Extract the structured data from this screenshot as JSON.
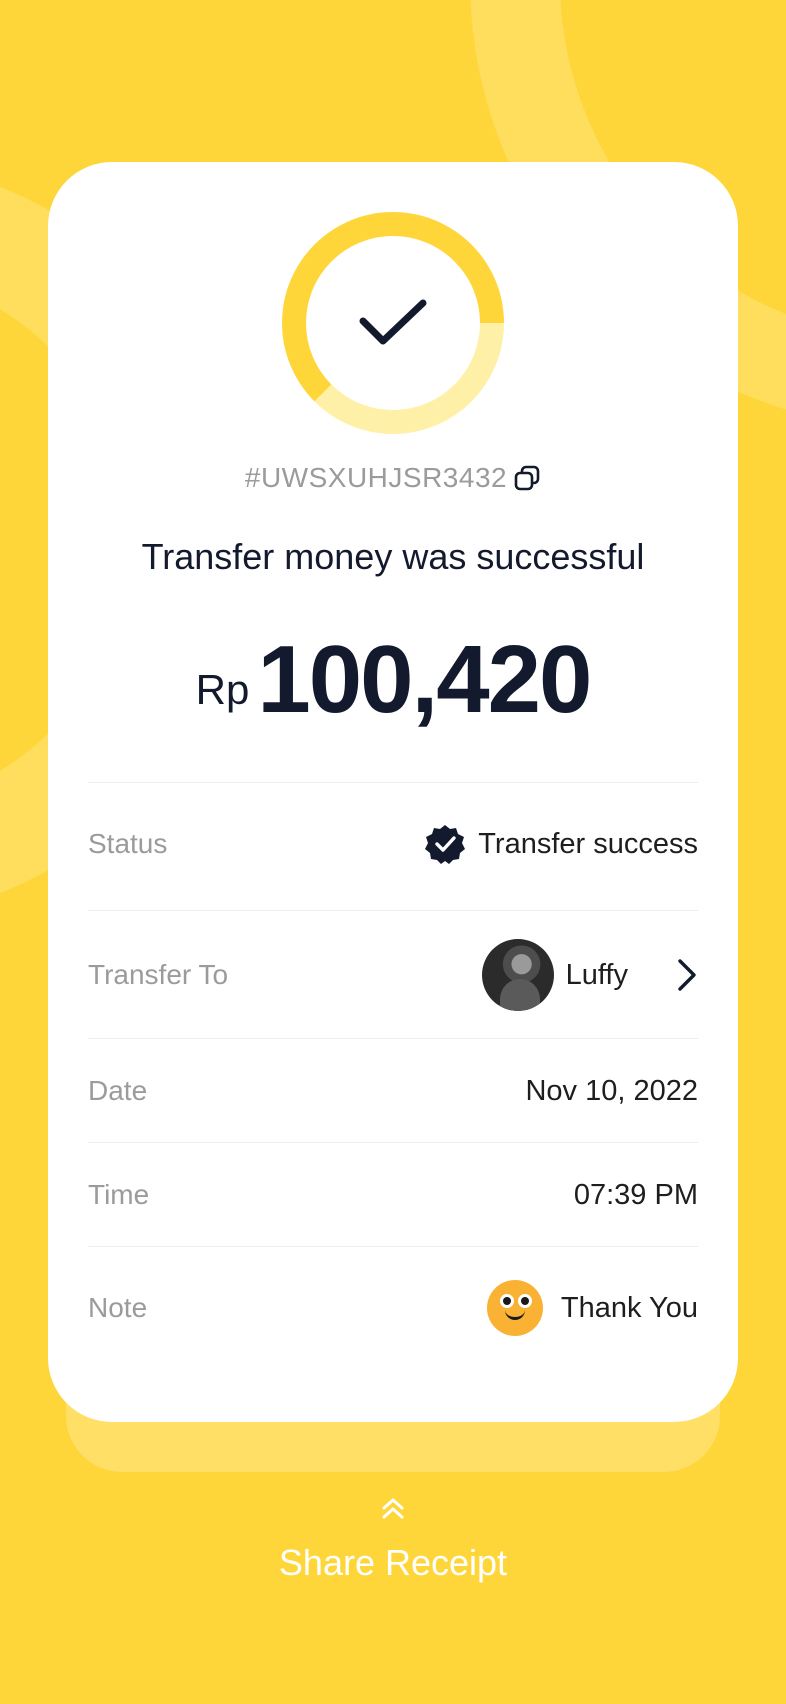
{
  "colors": {
    "background": "#FFD63A",
    "card": "#FFFFFF",
    "accent": "#FFD63A",
    "primary_text": "#141A2E",
    "muted_text": "#9B9B9B"
  },
  "receipt": {
    "transaction_id": "#UWSXUHJSR3432",
    "title": "Transfer money was successful",
    "currency": "Rp",
    "amount": "100,420"
  },
  "details": {
    "status": {
      "label": "Status",
      "value": "Transfer success",
      "icon": "verified-badge-icon"
    },
    "transfer_to": {
      "label": "Transfer To",
      "value": "Luffy",
      "icon": "chevron-right-icon"
    },
    "date": {
      "label": "Date",
      "value": "Nov 10, 2022"
    },
    "time": {
      "label": "Time",
      "value": "07:39 PM"
    },
    "note": {
      "label": "Note",
      "value": "Thank You",
      "icon": "smiley-emoji-icon"
    }
  },
  "share": {
    "label": "Share Receipt",
    "icon": "double-chevron-up-icon"
  }
}
